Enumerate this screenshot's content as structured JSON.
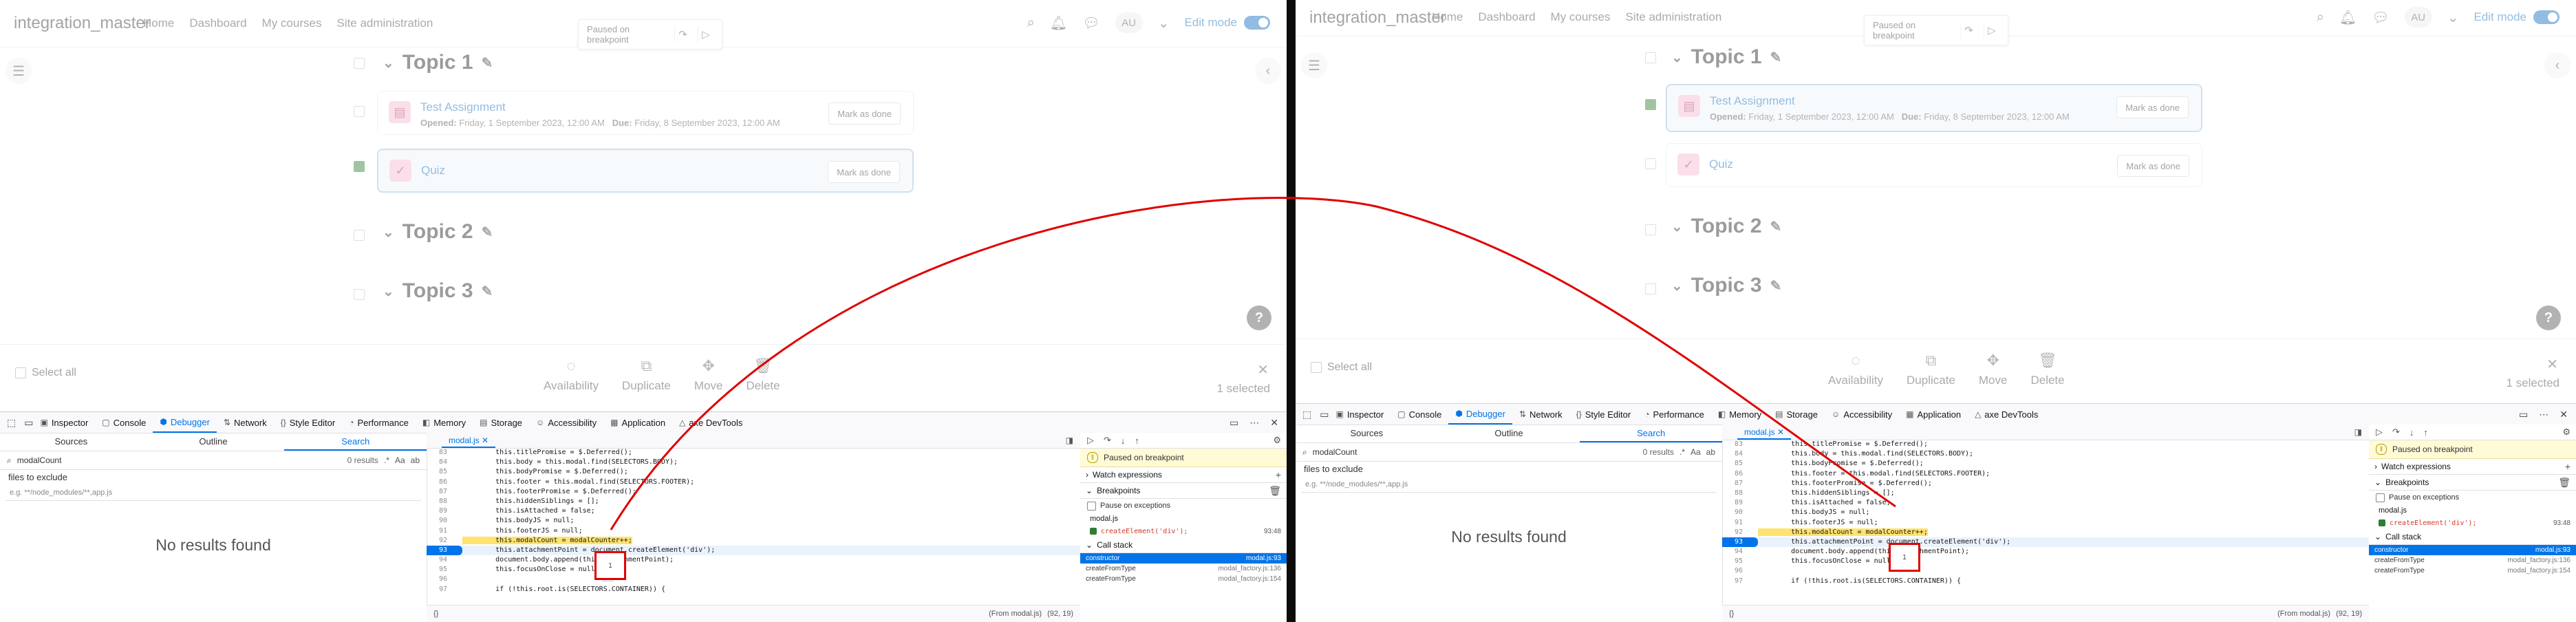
{
  "moodle": {
    "brand": "integration_master",
    "nav_links": [
      "Home",
      "Dashboard",
      "My courses",
      "Site administration"
    ],
    "avatar_initials": "AU",
    "edit_mode_label": "Edit mode",
    "paused_chip_label": "Paused on breakpoint",
    "topics": [
      "Topic 1",
      "Topic 2",
      "Topic 3"
    ],
    "activities": [
      {
        "title": "Test Assignment",
        "opened_label": "Opened:",
        "opened": "Friday, 1 September 2023, 12:00 AM",
        "due_label": "Due:",
        "due": "Friday, 8 September 2023, 12:00 AM",
        "button": "Mark as done"
      },
      {
        "title": "Quiz",
        "button": "Mark as done"
      }
    ],
    "bulk": {
      "select_all": "Select all",
      "actions": [
        "Availability",
        "Duplicate",
        "Move",
        "Delete"
      ],
      "selected_count": "1 selected"
    },
    "help": "?"
  },
  "devtools": {
    "tabs": [
      "Inspector",
      "Console",
      "Debugger",
      "Network",
      "Style Editor",
      "Performance",
      "Memory",
      "Storage",
      "Accessibility",
      "Application",
      "axe DevTools"
    ],
    "active_tab": "Debugger",
    "search_panel": {
      "tabs": [
        "Sources",
        "Outline",
        "Search"
      ],
      "query": "modalCount",
      "results": "0 results",
      "options": [
        ".*",
        "Aa",
        "ab"
      ],
      "files_to_exclude_label": "files to exclude",
      "files_placeholder": "e.g. **/node_modules/**,app.js",
      "no_results": "No results found"
    },
    "editor": {
      "file_tab": "modal.js",
      "pretty_print": "{}",
      "status_source": "(From modal.js)",
      "status_position": "(92, 19)",
      "inline_preview_left": "1",
      "inline_preview_right": "1",
      "lines": [
        {
          "n": "83",
          "code": "        this.titlePromise = $.Deferred();"
        },
        {
          "n": "84",
          "code": "        this.body = this.modal.find(SELECTORS.BODY);"
        },
        {
          "n": "85",
          "code": "        this.bodyPromise = $.Deferred();"
        },
        {
          "n": "86",
          "code": "        this.footer = this.modal.find(SELECTORS.FOOTER);"
        },
        {
          "n": "87",
          "code": "        this.footerPromise = $.Deferred();"
        },
        {
          "n": "88",
          "code": "        this.hiddenSiblings = [];"
        },
        {
          "n": "89",
          "code": "        this.isAttached = false;"
        },
        {
          "n": "90",
          "code": "        this.bodyJS = null;"
        },
        {
          "n": "91",
          "code": "        this.footerJS = null;"
        },
        {
          "n": "92",
          "code": "        this.modalCount = modalCounter++;"
        },
        {
          "n": "93",
          "code": "        this.attachmentPoint = document.createElement('div');"
        },
        {
          "n": "94",
          "code": "        document.body.append(this.attachmentPoint);"
        },
        {
          "n": "95",
          "code": "        this.focusOnClose = null;"
        },
        {
          "n": "96",
          "code": ""
        },
        {
          "n": "97",
          "code": "        if (!this.root.is(SELECTORS.CONTAINER)) {"
        }
      ]
    },
    "debugger": {
      "paused": "Paused on breakpoint",
      "watch_expressions": "Watch expressions",
      "breakpoints": "Breakpoints",
      "pause_on_exceptions": "Pause on exceptions",
      "bp_file": "modal.js",
      "bp_code": "createElement('div');",
      "bp_location": "93:48",
      "call_stack": "Call stack",
      "frames": [
        {
          "name": "constructor",
          "loc": "modal.js:93"
        },
        {
          "name": "createFromType",
          "loc": "modal_factory.js:136"
        },
        {
          "name": "createFromType",
          "loc": "modal_factory.js:154"
        }
      ]
    }
  },
  "colors": {
    "accent": "#0074e8",
    "moodle_blue": "#0f6cbf",
    "annotation_red": "#e00000",
    "complete_green": "#2e7d32"
  }
}
